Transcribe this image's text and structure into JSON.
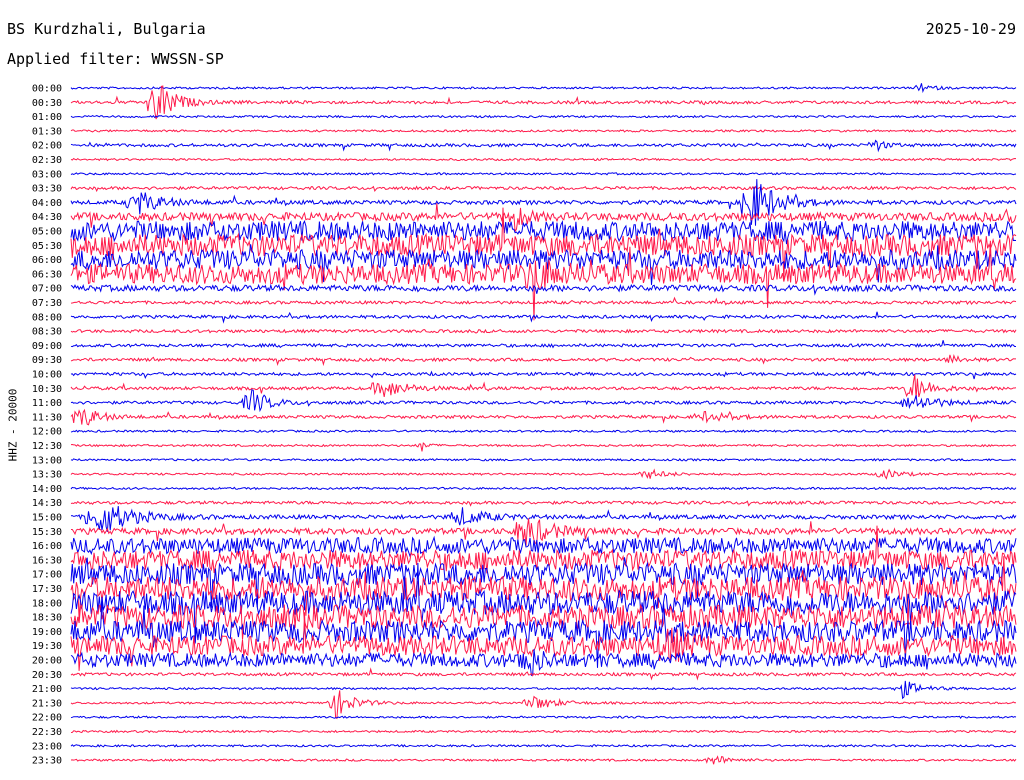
{
  "header": {
    "station": "BS Kurdzhali, Bulgaria",
    "date": "2025-10-29",
    "filter": "Applied filter: WWSSN-SP",
    "channel": "HHZ - 20000"
  },
  "colors": {
    "even_trace": "#0000ee",
    "odd_trace": "#ff1a4a",
    "text": "#000000"
  },
  "chart_data": {
    "type": "line",
    "title": "BS Kurdzhali, Bulgaria",
    "subtitle": "Applied filter: WWSSN-SP",
    "ylabel": "HHZ - 20000",
    "xlabel": "",
    "grid": false,
    "ticks": [
      "00:00",
      "00:30",
      "01:00",
      "01:30",
      "02:00",
      "02:30",
      "03:00",
      "03:30",
      "04:00",
      "04:30",
      "05:00",
      "05:30",
      "06:00",
      "06:30",
      "07:00",
      "07:30",
      "08:00",
      "08:30",
      "09:00",
      "09:30",
      "10:00",
      "10:30",
      "11:00",
      "11:30",
      "12:00",
      "12:30",
      "13:00",
      "13:30",
      "14:00",
      "14:30",
      "15:00",
      "15:30",
      "16:00",
      "16:30",
      "17:00",
      "17:30",
      "18:00",
      "18:30",
      "19:00",
      "19:30",
      "20:00",
      "20:30",
      "21:00",
      "21:30",
      "22:00",
      "22:30",
      "23:00",
      "23:30"
    ],
    "noise_levels": [
      1,
      1.5,
      1,
      1,
      1.5,
      1,
      1,
      1.5,
      2,
      4,
      10,
      11,
      10,
      10,
      3,
      1.5,
      1.5,
      1.5,
      1.5,
      1.5,
      1.5,
      1.5,
      1.5,
      1.5,
      1,
      1,
      1,
      1,
      1,
      1.5,
      2,
      3,
      8,
      10,
      11,
      12,
      12,
      12,
      11,
      10,
      7,
      1.5,
      1,
      1,
      1,
      1,
      1,
      1
    ],
    "bursts": [
      {
        "row": 1,
        "at": 0.09,
        "amp": 26,
        "width": 0.03
      },
      {
        "row": 0,
        "at": 0.9,
        "amp": 4,
        "width": 0.02
      },
      {
        "row": 4,
        "at": 0.85,
        "amp": 6,
        "width": 0.02
      },
      {
        "row": 8,
        "at": 0.07,
        "amp": 12,
        "width": 0.04
      },
      {
        "row": 8,
        "at": 0.72,
        "amp": 30,
        "width": 0.04
      },
      {
        "row": 9,
        "at": 0.47,
        "amp": 12,
        "width": 0.02
      },
      {
        "row": 9,
        "at": 0.99,
        "amp": 10,
        "width": 0.02
      },
      {
        "row": 13,
        "at": 0.49,
        "amp": 14,
        "width": 0.03
      },
      {
        "row": 19,
        "at": 0.93,
        "amp": 4,
        "width": 0.02
      },
      {
        "row": 21,
        "at": 0.33,
        "amp": 10,
        "width": 0.04
      },
      {
        "row": 21,
        "at": 0.89,
        "amp": 16,
        "width": 0.03
      },
      {
        "row": 22,
        "at": 0.19,
        "amp": 14,
        "width": 0.03
      },
      {
        "row": 22,
        "at": 0.89,
        "amp": 10,
        "width": 0.04
      },
      {
        "row": 23,
        "at": 0.01,
        "amp": 12,
        "width": 0.03
      },
      {
        "row": 23,
        "at": 0.67,
        "amp": 5,
        "width": 0.04
      },
      {
        "row": 25,
        "at": 0.37,
        "amp": 7,
        "width": 0.01
      },
      {
        "row": 27,
        "at": 0.61,
        "amp": 5,
        "width": 0.03
      },
      {
        "row": 27,
        "at": 0.86,
        "amp": 5,
        "width": 0.03
      },
      {
        "row": 30,
        "at": 0.03,
        "amp": 20,
        "width": 0.05
      },
      {
        "row": 30,
        "at": 0.41,
        "amp": 10,
        "width": 0.04
      },
      {
        "row": 31,
        "at": 0.48,
        "amp": 18,
        "width": 0.04
      },
      {
        "row": 40,
        "at": 0.48,
        "amp": 20,
        "width": 0.02
      },
      {
        "row": 39,
        "at": 0.63,
        "amp": 14,
        "width": 0.03
      },
      {
        "row": 42,
        "at": 0.88,
        "amp": 9,
        "width": 0.03
      },
      {
        "row": 43,
        "at": 0.28,
        "amp": 16,
        "width": 0.03
      },
      {
        "row": 43,
        "at": 0.49,
        "amp": 7,
        "width": 0.04
      },
      {
        "row": 47,
        "at": 0.68,
        "amp": 5,
        "width": 0.03
      }
    ]
  }
}
